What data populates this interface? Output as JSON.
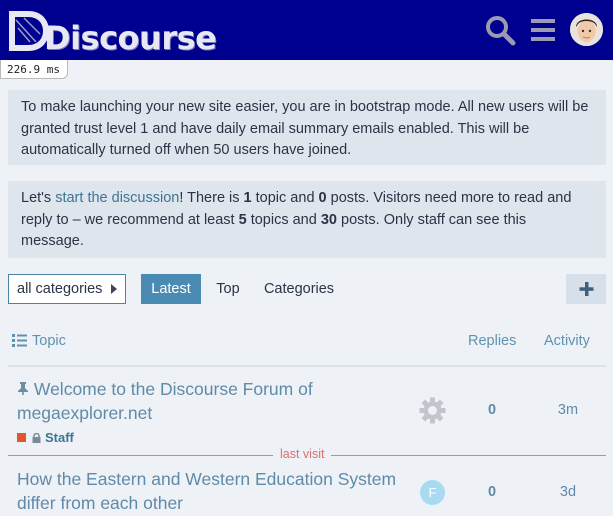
{
  "header": {
    "logo_text": "Discourse",
    "search_icon": "search-icon",
    "menu_icon": "hamburger-menu-icon",
    "avatar": "user-avatar"
  },
  "timer": "226.9 ms",
  "bootstrap_notice": "To make launching your new site easier, you are in bootstrap mode. All new users will be granted trust level 1 and have daily email summary emails enabled. This will be automatically turned off when 50 users have joined.",
  "start_notice": {
    "pre": "Let's ",
    "link": "start the discussion",
    "t1": "! There is ",
    "topics": "1",
    "t2": " topic and ",
    "posts": "0",
    "t3": " posts. Visitors need more to read and reply to – we recommend at least ",
    "rec_topics": "5",
    "t4": " topics and ",
    "rec_posts": "30",
    "t5": " posts. Only staff can see this message."
  },
  "nav": {
    "category_select": "all categories",
    "tabs": [
      "Latest",
      "Top",
      "Categories"
    ],
    "active_tab": "Latest",
    "new_topic_icon": "plus-icon"
  },
  "table": {
    "headers": {
      "topic": "Topic",
      "replies": "Replies",
      "activity": "Activity"
    }
  },
  "topics": [
    {
      "title": "Welcome to the Discourse Forum of megaexplorer.net",
      "pinned": true,
      "category": "Staff",
      "category_color": "#e3552d",
      "poster": "gear-avatar",
      "replies": "0",
      "activity": "3m"
    },
    {
      "title": "How the Eastern and Western Education System differ from each other",
      "pinned": false,
      "poster_letter": "F",
      "replies": "0",
      "activity": "3d"
    }
  ],
  "last_visit": "last visit",
  "colors": {
    "header_bg": "#00008f",
    "accent": "#4a8bb3",
    "link": "#5f8aa8",
    "staff": "#e3552d"
  }
}
